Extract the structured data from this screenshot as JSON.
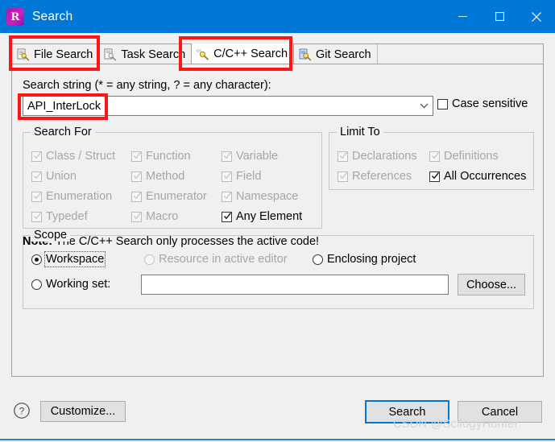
{
  "window": {
    "title": "Search",
    "app_icon": "r-logo-icon",
    "controls": {
      "minimize": "minimize-icon",
      "maximize": "maximize-icon",
      "close": "close-icon"
    },
    "titlebar_color": "#0078d7"
  },
  "tabs": [
    {
      "label": "File Search",
      "icon": "file-search-icon",
      "active": false
    },
    {
      "label": "Task Search",
      "icon": "task-search-icon",
      "active": false
    },
    {
      "label": "C/C++ Search",
      "icon": "cpp-search-icon",
      "active": true
    },
    {
      "label": "Git Search",
      "icon": "git-search-icon",
      "active": false
    }
  ],
  "search_string": {
    "label": "Search string (* = any string, ? = any character):",
    "value": "API_InterLock",
    "placeholder": "",
    "dropdown_icon": "chevron-down-icon"
  },
  "case_sensitive": {
    "label": "Case sensitive",
    "checked": false
  },
  "search_for": {
    "title": "Search For",
    "items": [
      {
        "label": "Class / Struct",
        "checked": true,
        "enabled": false
      },
      {
        "label": "Function",
        "checked": true,
        "enabled": false
      },
      {
        "label": "Variable",
        "checked": true,
        "enabled": false
      },
      {
        "label": "Union",
        "checked": true,
        "enabled": false
      },
      {
        "label": "Method",
        "checked": true,
        "enabled": false
      },
      {
        "label": "Field",
        "checked": true,
        "enabled": false
      },
      {
        "label": "Enumeration",
        "checked": true,
        "enabled": false
      },
      {
        "label": "Enumerator",
        "checked": true,
        "enabled": false
      },
      {
        "label": "Namespace",
        "checked": true,
        "enabled": false
      },
      {
        "label": "Typedef",
        "checked": true,
        "enabled": false
      },
      {
        "label": "Macro",
        "checked": true,
        "enabled": false
      },
      {
        "label": "Any Element",
        "checked": true,
        "enabled": true
      }
    ]
  },
  "limit_to": {
    "title": "Limit To",
    "items": [
      {
        "label": "Declarations",
        "checked": true,
        "enabled": false
      },
      {
        "label": "Definitions",
        "checked": true,
        "enabled": false
      },
      {
        "label": "References",
        "checked": true,
        "enabled": false
      },
      {
        "label": "All Occurrences",
        "checked": true,
        "enabled": true
      }
    ]
  },
  "note": {
    "prefix": "Note:",
    "text": "The C/C++ Search only processes the active code!"
  },
  "scope": {
    "title": "Scope",
    "radios": [
      {
        "label": "Workspace",
        "selected": true,
        "enabled": true,
        "focused": true
      },
      {
        "label": "Resource in active editor",
        "selected": false,
        "enabled": false,
        "focused": false
      },
      {
        "label": "Enclosing project",
        "selected": false,
        "enabled": true,
        "focused": false
      },
      {
        "label": "Working set:",
        "selected": false,
        "enabled": true,
        "focused": false
      }
    ],
    "working_set_value": "",
    "working_set_placeholder": "",
    "choose_label": "Choose..."
  },
  "footer": {
    "help_icon": "help-question-icon",
    "customize_label": "Customize...",
    "search_label": "Search",
    "cancel_label": "Cancel",
    "watermark": "CSDN @ScilogyHunter"
  },
  "annotations": {
    "accent_color": "#fc1616",
    "boxes": [
      "file-search-tab",
      "cpp-search-tab",
      "search-string-value"
    ]
  }
}
